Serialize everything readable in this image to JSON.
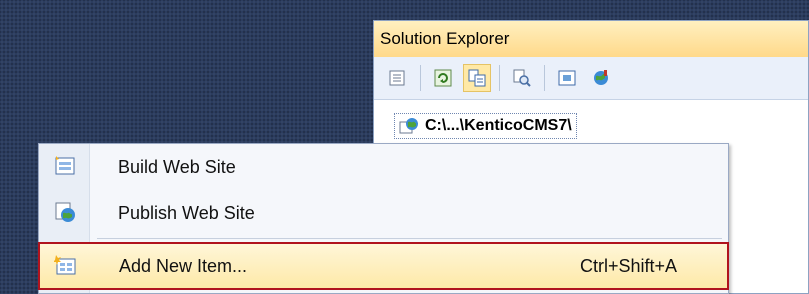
{
  "solution_explorer": {
    "title": "Solution Explorer",
    "toolbar_icons": [
      "properties-icon",
      "refresh-icon",
      "nest-files-icon",
      "view-code-icon",
      "view-designer-icon",
      "browse-icon"
    ],
    "tree_root_label": "C:\\...\\KenticoCMS7\\"
  },
  "context_menu": {
    "items": [
      {
        "label": "Build Web Site",
        "shortcut": "",
        "icon": "build-icon"
      },
      {
        "label": "Publish Web Site",
        "shortcut": "",
        "icon": "publish-icon"
      },
      {
        "label": "Add New Item...",
        "shortcut": "Ctrl+Shift+A",
        "icon": "add-new-item-icon",
        "highlighted": true
      }
    ]
  },
  "colors": {
    "highlight_outline": "#b0131e",
    "panel_title_bg": "#ffd98a"
  }
}
